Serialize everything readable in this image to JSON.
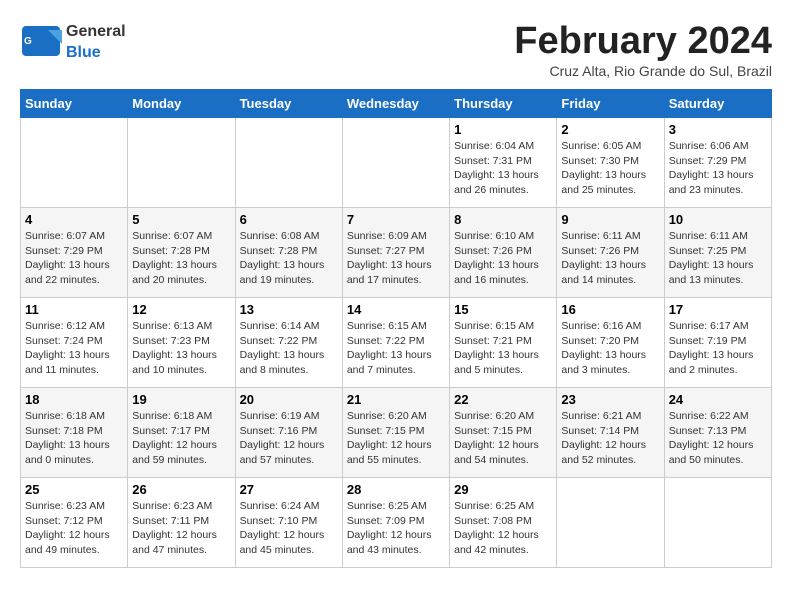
{
  "header": {
    "logo_general": "General",
    "logo_blue": "Blue",
    "month_title": "February 2024",
    "location": "Cruz Alta, Rio Grande do Sul, Brazil"
  },
  "days_of_week": [
    "Sunday",
    "Monday",
    "Tuesday",
    "Wednesday",
    "Thursday",
    "Friday",
    "Saturday"
  ],
  "weeks": [
    [
      {
        "day": "",
        "info": ""
      },
      {
        "day": "",
        "info": ""
      },
      {
        "day": "",
        "info": ""
      },
      {
        "day": "",
        "info": ""
      },
      {
        "day": "1",
        "info": "Sunrise: 6:04 AM\nSunset: 7:31 PM\nDaylight: 13 hours and 26 minutes."
      },
      {
        "day": "2",
        "info": "Sunrise: 6:05 AM\nSunset: 7:30 PM\nDaylight: 13 hours and 25 minutes."
      },
      {
        "day": "3",
        "info": "Sunrise: 6:06 AM\nSunset: 7:29 PM\nDaylight: 13 hours and 23 minutes."
      }
    ],
    [
      {
        "day": "4",
        "info": "Sunrise: 6:07 AM\nSunset: 7:29 PM\nDaylight: 13 hours and 22 minutes."
      },
      {
        "day": "5",
        "info": "Sunrise: 6:07 AM\nSunset: 7:28 PM\nDaylight: 13 hours and 20 minutes."
      },
      {
        "day": "6",
        "info": "Sunrise: 6:08 AM\nSunset: 7:28 PM\nDaylight: 13 hours and 19 minutes."
      },
      {
        "day": "7",
        "info": "Sunrise: 6:09 AM\nSunset: 7:27 PM\nDaylight: 13 hours and 17 minutes."
      },
      {
        "day": "8",
        "info": "Sunrise: 6:10 AM\nSunset: 7:26 PM\nDaylight: 13 hours and 16 minutes."
      },
      {
        "day": "9",
        "info": "Sunrise: 6:11 AM\nSunset: 7:26 PM\nDaylight: 13 hours and 14 minutes."
      },
      {
        "day": "10",
        "info": "Sunrise: 6:11 AM\nSunset: 7:25 PM\nDaylight: 13 hours and 13 minutes."
      }
    ],
    [
      {
        "day": "11",
        "info": "Sunrise: 6:12 AM\nSunset: 7:24 PM\nDaylight: 13 hours and 11 minutes."
      },
      {
        "day": "12",
        "info": "Sunrise: 6:13 AM\nSunset: 7:23 PM\nDaylight: 13 hours and 10 minutes."
      },
      {
        "day": "13",
        "info": "Sunrise: 6:14 AM\nSunset: 7:22 PM\nDaylight: 13 hours and 8 minutes."
      },
      {
        "day": "14",
        "info": "Sunrise: 6:15 AM\nSunset: 7:22 PM\nDaylight: 13 hours and 7 minutes."
      },
      {
        "day": "15",
        "info": "Sunrise: 6:15 AM\nSunset: 7:21 PM\nDaylight: 13 hours and 5 minutes."
      },
      {
        "day": "16",
        "info": "Sunrise: 6:16 AM\nSunset: 7:20 PM\nDaylight: 13 hours and 3 minutes."
      },
      {
        "day": "17",
        "info": "Sunrise: 6:17 AM\nSunset: 7:19 PM\nDaylight: 13 hours and 2 minutes."
      }
    ],
    [
      {
        "day": "18",
        "info": "Sunrise: 6:18 AM\nSunset: 7:18 PM\nDaylight: 13 hours and 0 minutes."
      },
      {
        "day": "19",
        "info": "Sunrise: 6:18 AM\nSunset: 7:17 PM\nDaylight: 12 hours and 59 minutes."
      },
      {
        "day": "20",
        "info": "Sunrise: 6:19 AM\nSunset: 7:16 PM\nDaylight: 12 hours and 57 minutes."
      },
      {
        "day": "21",
        "info": "Sunrise: 6:20 AM\nSunset: 7:15 PM\nDaylight: 12 hours and 55 minutes."
      },
      {
        "day": "22",
        "info": "Sunrise: 6:20 AM\nSunset: 7:15 PM\nDaylight: 12 hours and 54 minutes."
      },
      {
        "day": "23",
        "info": "Sunrise: 6:21 AM\nSunset: 7:14 PM\nDaylight: 12 hours and 52 minutes."
      },
      {
        "day": "24",
        "info": "Sunrise: 6:22 AM\nSunset: 7:13 PM\nDaylight: 12 hours and 50 minutes."
      }
    ],
    [
      {
        "day": "25",
        "info": "Sunrise: 6:23 AM\nSunset: 7:12 PM\nDaylight: 12 hours and 49 minutes."
      },
      {
        "day": "26",
        "info": "Sunrise: 6:23 AM\nSunset: 7:11 PM\nDaylight: 12 hours and 47 minutes."
      },
      {
        "day": "27",
        "info": "Sunrise: 6:24 AM\nSunset: 7:10 PM\nDaylight: 12 hours and 45 minutes."
      },
      {
        "day": "28",
        "info": "Sunrise: 6:25 AM\nSunset: 7:09 PM\nDaylight: 12 hours and 43 minutes."
      },
      {
        "day": "29",
        "info": "Sunrise: 6:25 AM\nSunset: 7:08 PM\nDaylight: 12 hours and 42 minutes."
      },
      {
        "day": "",
        "info": ""
      },
      {
        "day": "",
        "info": ""
      }
    ]
  ]
}
